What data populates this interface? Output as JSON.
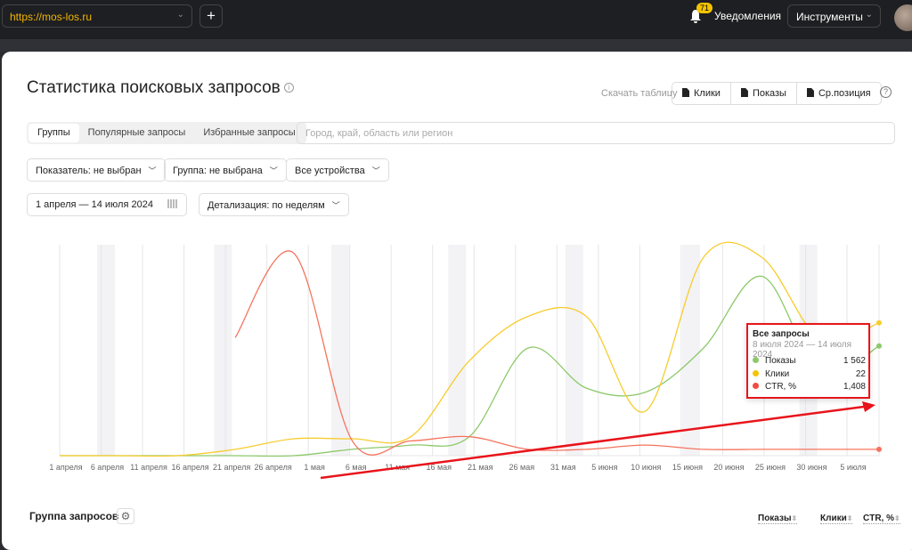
{
  "topbar": {
    "site": "https://mos-los.ru",
    "add": "+",
    "notif_count": "71",
    "notifications": "Уведомления",
    "tools": "Инструменты"
  },
  "page": {
    "title": "Статистика поисковых запросов",
    "download_label": "Скачать таблицу",
    "downloads": [
      "Клики",
      "Показы",
      "Ср.позиция"
    ],
    "help": "?"
  },
  "tabs": [
    "Группы",
    "Популярные запросы",
    "Избранные запросы"
  ],
  "region_placeholder": "Город, край, область или регион",
  "filters": {
    "metric": "Показатель: не выбран",
    "group": "Группа: не выбрана",
    "devices": "Все устройства",
    "dates": "1 апреля — 14 июля 2024",
    "detail": "Детализация: по неделям"
  },
  "chart_data": {
    "type": "line",
    "x_ticks": [
      "1 апреля",
      "6 апреля",
      "11 апреля",
      "16 апреля",
      "21 апреля",
      "26 апреля",
      "1 мая",
      "6 мая",
      "11 мая",
      "16 мая",
      "21 мая",
      "26 мая",
      "31 мая",
      "5 июня",
      "10 июня",
      "15 июня",
      "20 июня",
      "25 июня",
      "30 июня",
      "5 июля"
    ],
    "weeks": 15,
    "ylim": [
      0,
      100
    ],
    "series": [
      {
        "name": "Показы",
        "color": "#8cc96a",
        "values": [
          0,
          0,
          0,
          0,
          0,
          3,
          5,
          9,
          51,
          32,
          30,
          51,
          85,
          39,
          52
        ]
      },
      {
        "name": "Клики",
        "color": "#f7cc2e",
        "values": [
          0,
          0,
          0,
          3,
          8,
          8,
          9,
          45,
          66,
          66,
          21,
          94,
          94,
          55,
          63
        ]
      },
      {
        "name": "CTR, %",
        "color": "#f5735e",
        "values": [
          null,
          null,
          null,
          56,
          96,
          7,
          7,
          9,
          3,
          3,
          5,
          3,
          3,
          3,
          3
        ]
      }
    ]
  },
  "tooltip": {
    "title": "Все запросы",
    "dates": "8 июля 2024 — 14 июля 2024",
    "rows": [
      {
        "label": "Показы",
        "value": "1 562",
        "color": "#8cc96a"
      },
      {
        "label": "Клики",
        "value": "22",
        "color": "#f5c400"
      },
      {
        "label": "CTR, %",
        "value": "1,408",
        "color": "#f24b3f"
      }
    ]
  },
  "table": {
    "title": "Группа запросов",
    "columns": [
      "Показы",
      "Клики",
      "CTR, %"
    ]
  }
}
